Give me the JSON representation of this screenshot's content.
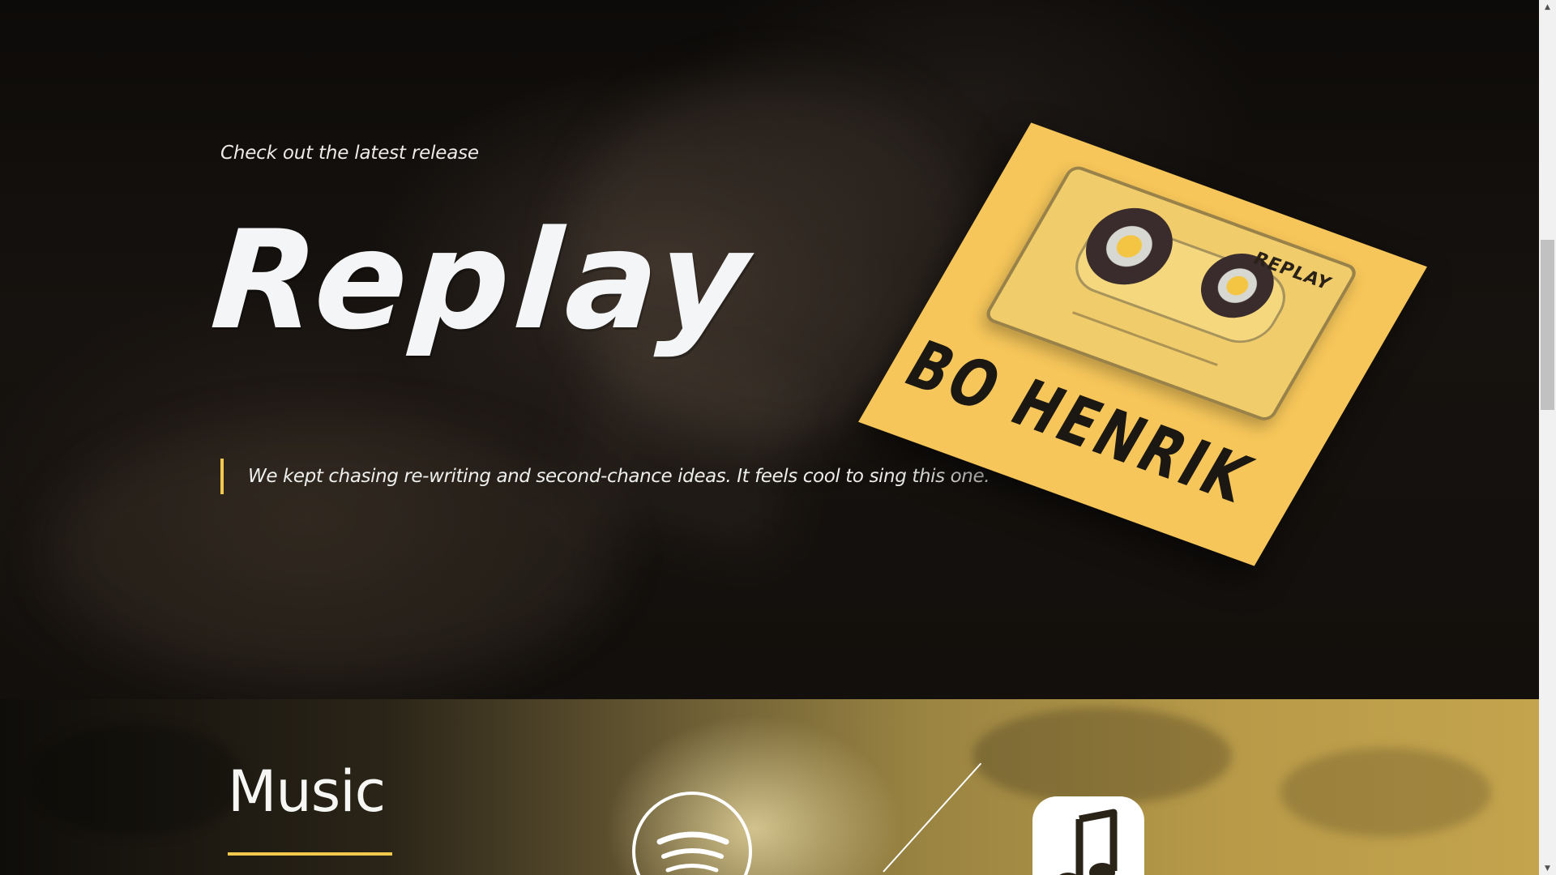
{
  "hero": {
    "eyebrow": "Check out the latest release",
    "title": "Replay",
    "quote": "We kept chasing re-writing and second-chance ideas. It feels cool to sing this one.",
    "accent_color": "#f2c94c"
  },
  "album": {
    "cassette_label": "REPLAY",
    "artist": "BO HENRIK",
    "cover_color": "#f6c65a"
  },
  "music": {
    "title": "Music",
    "links": [
      {
        "name": "spotify-icon"
      },
      {
        "name": "apple-music-icon"
      }
    ]
  },
  "scrollbar": {
    "up_arrow": "▲",
    "down_arrow": "▼"
  }
}
